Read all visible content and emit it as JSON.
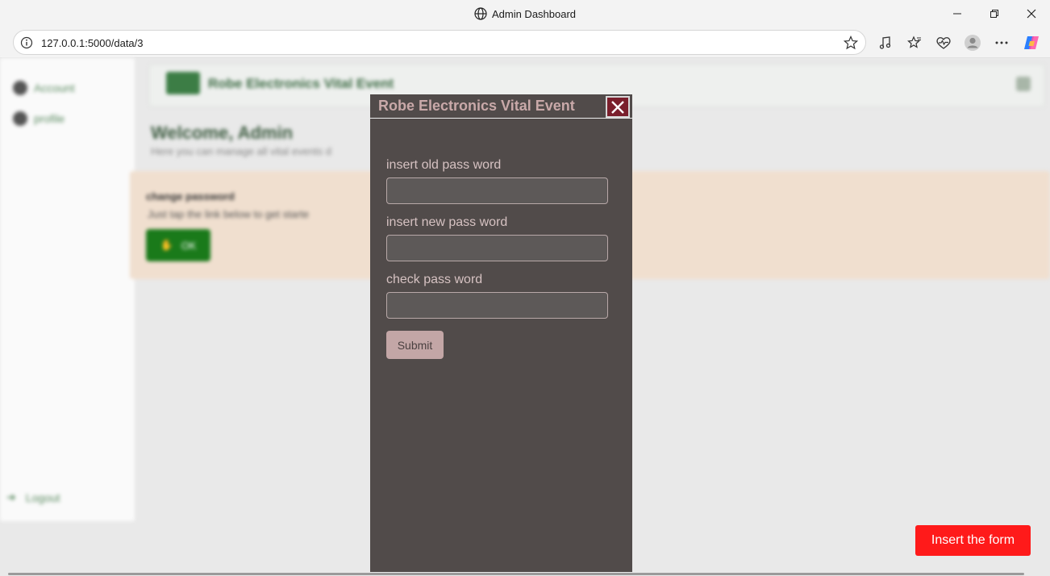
{
  "window": {
    "title": "Admin Dashboard"
  },
  "browser": {
    "url": "127.0.0.1:5000/data/3"
  },
  "background": {
    "brand": "Robe Electronics Vital Event",
    "sidebar_items": [
      "Account",
      "profile"
    ],
    "logout_label": "Logout",
    "welcome": "Welcome, Admin",
    "welcome_sub": "Here you can manage all vital events d",
    "alert_heading": "change password",
    "alert_text": "Just tap the link below to get starte",
    "alert_button": "OK"
  },
  "insert_button": "Insert the form",
  "modal": {
    "title": "Robe Electronics Vital Event",
    "fields": [
      {
        "label": "insert old pass word",
        "value": ""
      },
      {
        "label": "insert new pass word",
        "value": ""
      },
      {
        "label": "check pass word",
        "value": ""
      }
    ],
    "submit_label": "Submit"
  },
  "colors": {
    "modal_bg": "#514b4a",
    "insert_button": "#ff1a1a",
    "close_button": "#7a1f2c",
    "alert_bg": "#f0dfcf"
  }
}
